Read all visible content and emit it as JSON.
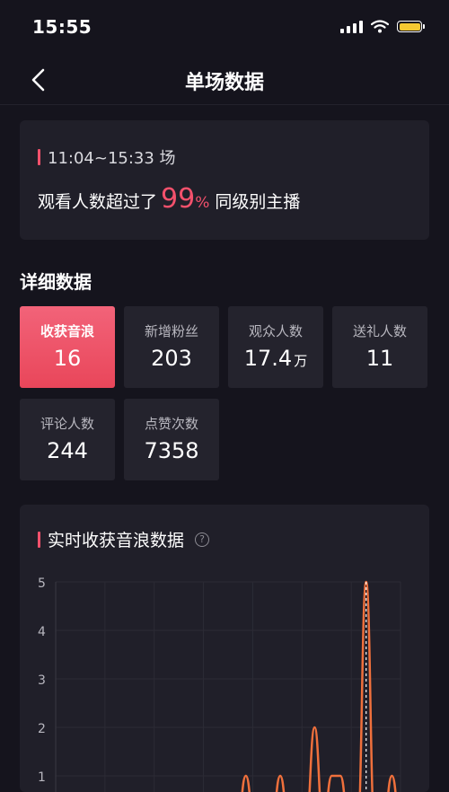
{
  "status_bar": {
    "time": "15:55"
  },
  "nav": {
    "title": "单场数据"
  },
  "session": {
    "time_range": "11:04~15:33 场",
    "summary_prefix": "观看人数超过了",
    "percent": "99",
    "percent_sign": "%",
    "summary_suffix": "同级别主播"
  },
  "details": {
    "title": "详细数据",
    "stats": [
      {
        "label": "收获音浪",
        "value": "16",
        "unit": ""
      },
      {
        "label": "新增粉丝",
        "value": "203",
        "unit": ""
      },
      {
        "label": "观众人数",
        "value": "17.4",
        "unit": "万"
      },
      {
        "label": "送礼人数",
        "value": "11",
        "unit": ""
      },
      {
        "label": "评论人数",
        "value": "244",
        "unit": ""
      },
      {
        "label": "点赞次数",
        "value": "7358",
        "unit": ""
      }
    ]
  },
  "realtime": {
    "title": "实时收获音浪数据",
    "help": "?"
  },
  "colors": {
    "accent": "#f4516c",
    "line": "#f0703c",
    "background": "#15141d",
    "card": "#201f29"
  },
  "chart_data": {
    "type": "line",
    "title": "实时收获音浪数据",
    "xlabel": "",
    "ylabel": "",
    "ylim": [
      0,
      5
    ],
    "yticks": [
      "1",
      "2",
      "3",
      "4",
      "5"
    ],
    "grid": true,
    "series": [
      {
        "values": [
          0,
          0,
          0,
          0,
          0,
          0,
          0,
          0,
          0,
          0,
          0,
          0,
          0,
          0,
          0,
          0,
          0,
          0,
          0,
          1,
          0,
          0,
          0,
          1,
          0,
          0,
          0,
          2,
          0,
          1,
          1,
          0,
          0,
          5,
          0,
          0,
          1,
          0
        ]
      }
    ]
  }
}
